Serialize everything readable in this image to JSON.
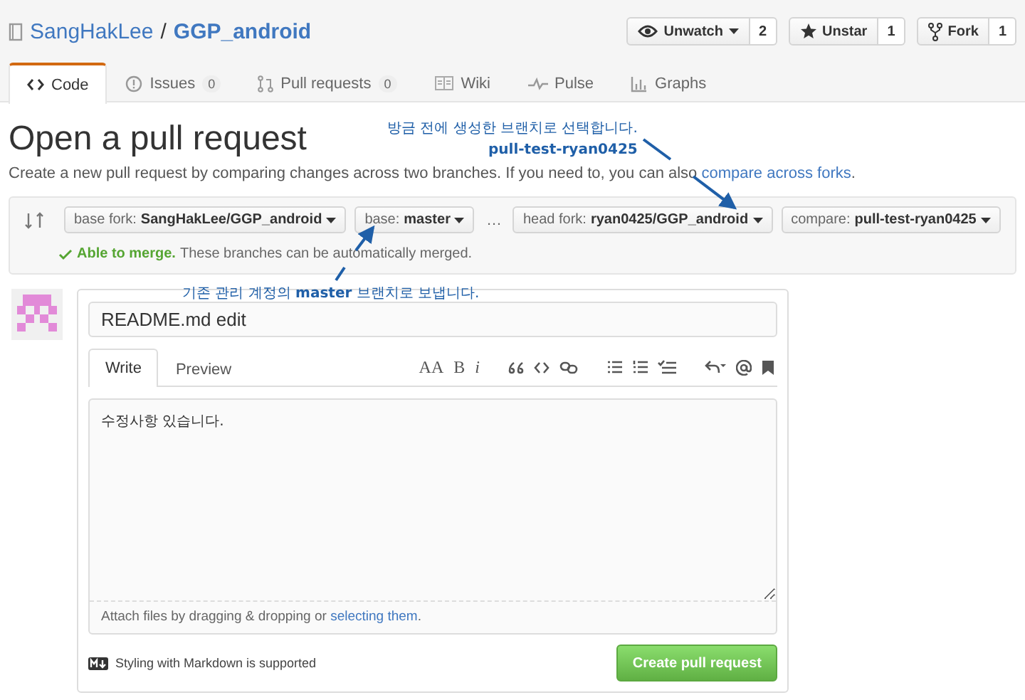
{
  "repo": {
    "owner": "SangHakLee",
    "separator": "/",
    "name": "GGP_android"
  },
  "actions": [
    {
      "kind": "watch",
      "label": "Unwatch",
      "count": "2",
      "caret": true
    },
    {
      "kind": "star",
      "label": "Unstar",
      "count": "1",
      "caret": false
    },
    {
      "kind": "fork",
      "label": "Fork",
      "count": "1",
      "caret": false
    }
  ],
  "tabs": [
    {
      "kind": "code",
      "label": "Code",
      "selected": true
    },
    {
      "kind": "issues",
      "label": "Issues",
      "count": "0",
      "selected": false
    },
    {
      "kind": "pr",
      "label": "Pull requests",
      "count": "0",
      "selected": false
    },
    {
      "kind": "wiki",
      "label": "Wiki",
      "selected": false
    },
    {
      "kind": "pulse",
      "label": "Pulse",
      "selected": false
    },
    {
      "kind": "graphs",
      "label": "Graphs",
      "selected": false
    }
  ],
  "page": {
    "title": "Open a pull request",
    "description": "Create a new pull request by comparing changes across two branches. If you need to, you can also",
    "description_link": "compare across forks",
    "description_end": "."
  },
  "compare": {
    "base": [
      {
        "prefix": "base fork:",
        "value": "SangHakLee/GGP_android"
      },
      {
        "prefix": "base:",
        "value": "master"
      }
    ],
    "separator": "…",
    "head": [
      {
        "prefix": "head fork:",
        "value": "ryan0425/GGP_android"
      },
      {
        "prefix": "compare:",
        "value": "pull-test-ryan0425"
      }
    ],
    "merge_status": "Able to merge.",
    "merge_note": "These branches can be automatically merged."
  },
  "form": {
    "title_value": "README.md edit",
    "tabs": [
      {
        "label": "Write",
        "selected": true
      },
      {
        "label": "Preview",
        "selected": false
      }
    ],
    "toolbar": [
      {
        "kind": "text",
        "glyph": "AA"
      },
      {
        "kind": "text",
        "glyph": "B"
      },
      {
        "kind": "italic",
        "glyph": "i"
      },
      {
        "kind": "quote"
      },
      {
        "kind": "code"
      },
      {
        "kind": "link"
      },
      {
        "kind": "ul"
      },
      {
        "kind": "ol"
      },
      {
        "kind": "task"
      },
      {
        "kind": "reply"
      },
      {
        "kind": "mention"
      },
      {
        "kind": "bookmark"
      }
    ],
    "body_value": "수정사항 있습니다.",
    "attach_text": "Attach files by dragging & dropping or",
    "attach_link": "selecting them",
    "attach_end": ".",
    "markdown_note": "Styling with Markdown is supported",
    "submit": "Create pull request"
  },
  "annotations": [
    {
      "text": "방금 전에 생성한 브랜치로 선택합니다.",
      "highlight": "pull-test-ryan0425"
    },
    {
      "text": "기존 관리 계정의 **master** 브랜치로 보냅니다."
    }
  ]
}
